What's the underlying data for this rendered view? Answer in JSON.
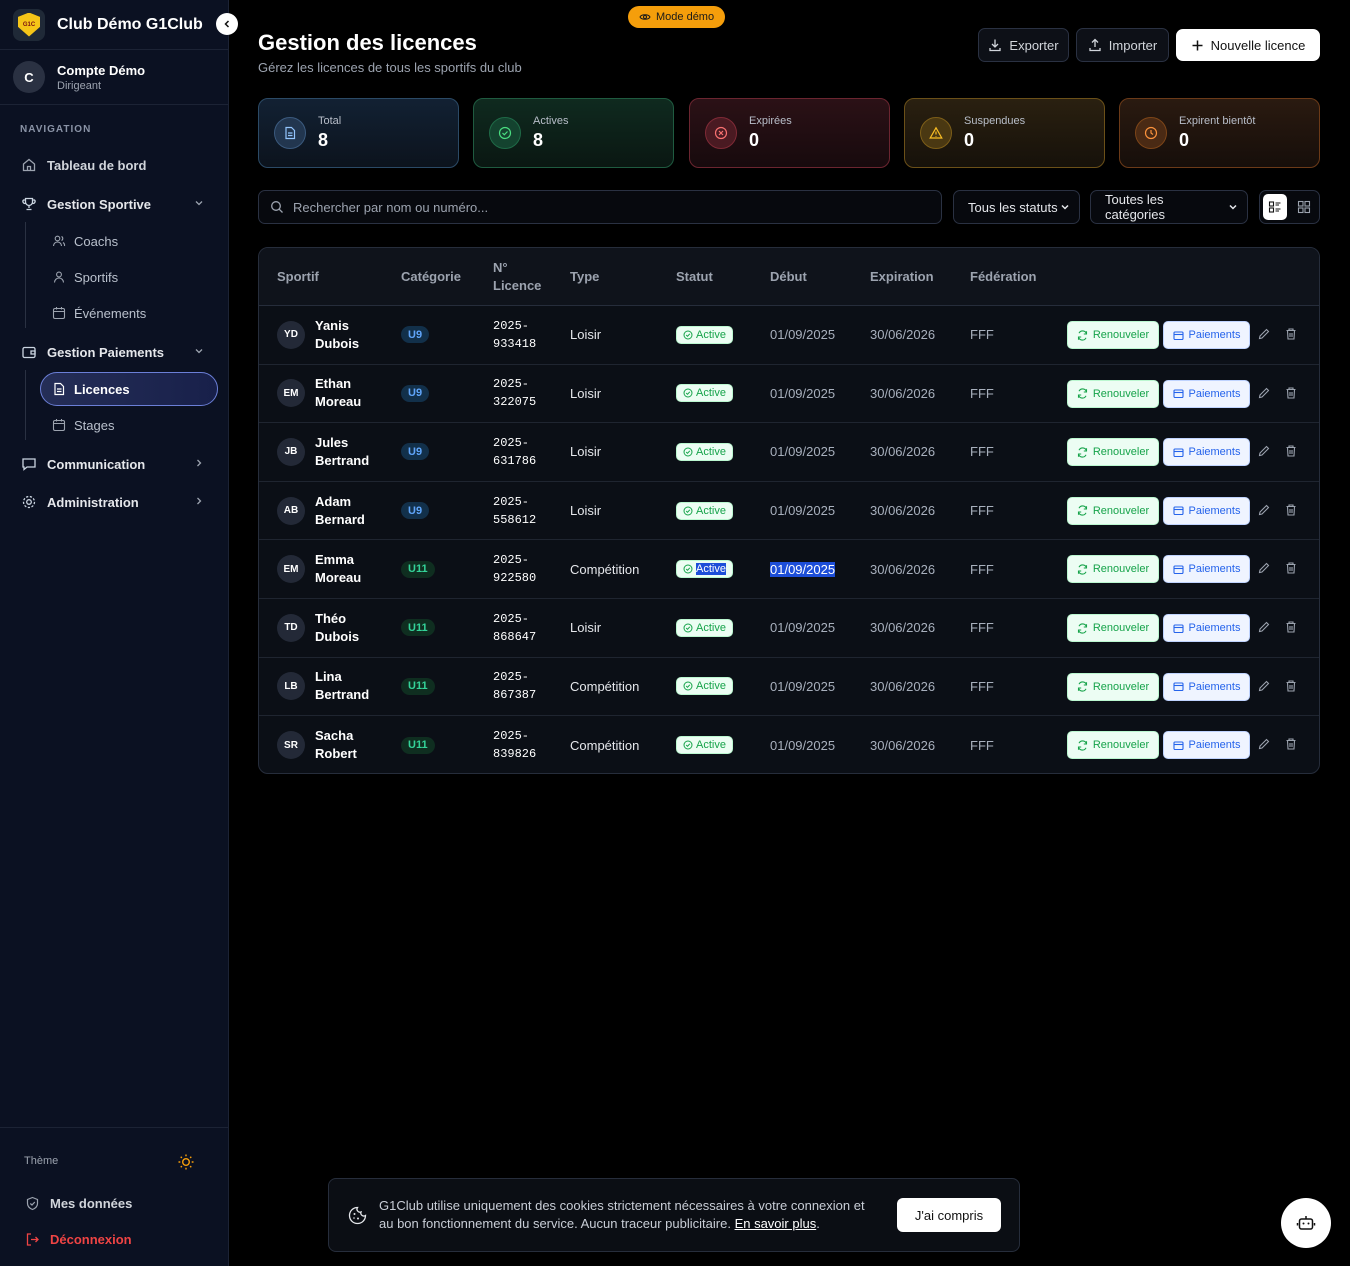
{
  "colors": {
    "accent": "#f59e0b",
    "active": "#16a34a",
    "link": "#2563eb",
    "danger": "#ef4444"
  },
  "sidebar": {
    "club_name": "Club Démo G1Club",
    "logo_text": "G1C",
    "account": {
      "initial": "C",
      "name": "Compte Démo",
      "role": "Dirigeant"
    },
    "nav_label": "NAVIGATION",
    "items": {
      "dashboard": "Tableau de bord",
      "sport": "Gestion Sportive",
      "coachs": "Coachs",
      "sportifs": "Sportifs",
      "events": "Événements",
      "payments": "Gestion Paiements",
      "licences": "Licences",
      "stages": "Stages",
      "communication": "Communication",
      "admin": "Administration"
    },
    "theme_label": "Thème",
    "my_data": "Mes données",
    "logout": "Déconnexion"
  },
  "header": {
    "demo_badge": "Mode démo",
    "title": "Gestion des licences",
    "subtitle": "Gérez les licences de tous les sportifs du club",
    "export": "Exporter",
    "import": "Importer",
    "new": "Nouvelle licence"
  },
  "stats": {
    "total": {
      "label": "Total",
      "value": "8"
    },
    "active": {
      "label": "Actives",
      "value": "8"
    },
    "expired": {
      "label": "Expirées",
      "value": "0"
    },
    "suspended": {
      "label": "Suspendues",
      "value": "0"
    },
    "soon": {
      "label": "Expirent bientôt",
      "value": "0"
    }
  },
  "filters": {
    "search_placeholder": "Rechercher par nom ou numéro...",
    "status": "Tous les statuts",
    "category": "Toutes les catégories"
  },
  "table": {
    "headers": {
      "sportif": "Sportif",
      "categorie": "Catégorie",
      "licence1": "N°",
      "licence2": "Licence",
      "type": "Type",
      "statut": "Statut",
      "debut": "Début",
      "expiration": "Expiration",
      "federation": "Fédération"
    },
    "renew_label": "Renouveler",
    "pay_label": "Paiements",
    "rows": [
      {
        "initials": "YD",
        "first": "Yanis",
        "last": "Dubois",
        "cat": "U9",
        "lic1": "2025-",
        "lic2": "933418",
        "type": "Loisir",
        "status": "Active",
        "start": "01/09/2025",
        "end": "30/06/2026",
        "fed": "FFF"
      },
      {
        "initials": "EM",
        "first": "Ethan",
        "last": "Moreau",
        "cat": "U9",
        "lic1": "2025-",
        "lic2": "322075",
        "type": "Loisir",
        "status": "Active",
        "start": "01/09/2025",
        "end": "30/06/2026",
        "fed": "FFF"
      },
      {
        "initials": "JB",
        "first": "Jules",
        "last": "Bertrand",
        "cat": "U9",
        "lic1": "2025-",
        "lic2": "631786",
        "type": "Loisir",
        "status": "Active",
        "start": "01/09/2025",
        "end": "30/06/2026",
        "fed": "FFF"
      },
      {
        "initials": "AB",
        "first": "Adam",
        "last": "Bernard",
        "cat": "U9",
        "lic1": "2025-",
        "lic2": "558612",
        "type": "Loisir",
        "status": "Active",
        "start": "01/09/2025",
        "end": "30/06/2026",
        "fed": "FFF"
      },
      {
        "initials": "EM",
        "first": "Emma",
        "last": "Moreau",
        "cat": "U11",
        "lic1": "2025-",
        "lic2": "922580",
        "type": "Compétition",
        "status": "Active",
        "start": "01/09/2025",
        "end": "30/06/2026",
        "fed": "FFF"
      },
      {
        "initials": "TD",
        "first": "Théo",
        "last": "Dubois",
        "cat": "U11",
        "lic1": "2025-",
        "lic2": "868647",
        "type": "Loisir",
        "status": "Active",
        "start": "01/09/2025",
        "end": "30/06/2026",
        "fed": "FFF"
      },
      {
        "initials": "LB",
        "first": "Lina",
        "last": "Bertrand",
        "cat": "U11",
        "lic1": "2025-",
        "lic2": "867387",
        "type": "Compétition",
        "status": "Active",
        "start": "01/09/2025",
        "end": "30/06/2026",
        "fed": "FFF"
      },
      {
        "initials": "SR",
        "first": "Sacha",
        "last": "Robert",
        "cat": "U11",
        "lic1": "2025-",
        "lic2": "839826",
        "type": "Compétition",
        "status": "Active",
        "start": "01/09/2025",
        "end": "30/06/2026",
        "fed": "FFF"
      }
    ]
  },
  "cookie": {
    "text": "G1Club utilise uniquement des cookies strictement nécessaires à votre connexion et au bon fonctionnement du service. Aucun traceur publicitaire.",
    "link": "En savoir plus",
    "button": "J'ai compris"
  }
}
